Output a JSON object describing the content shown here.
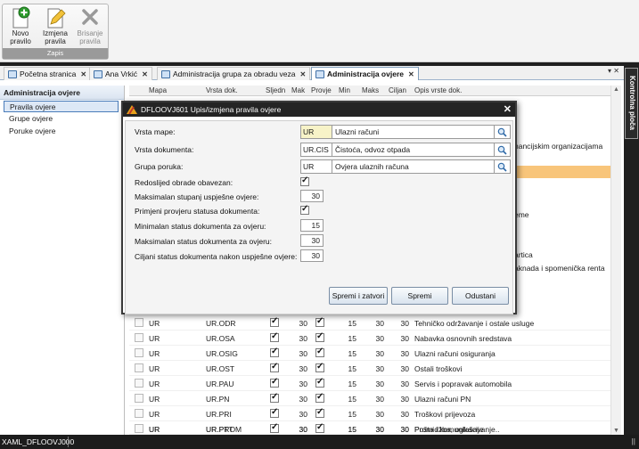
{
  "ribbon": {
    "buttons": [
      {
        "label_line1": "Novo",
        "label_line2": "pravilo",
        "icon": "new-document-icon"
      },
      {
        "label_line1": "Izmjena",
        "label_line2": "pravila",
        "icon": "edit-document-icon"
      },
      {
        "label_line1": "Brisanje",
        "label_line2": "pravila",
        "icon": "delete-x-icon"
      }
    ],
    "group_label": "Zapis"
  },
  "tabs": [
    {
      "label": "Početna stranica"
    },
    {
      "label": "Ana Vrkić"
    },
    {
      "label": "Administracija grupa za obradu veza"
    },
    {
      "label": "Administracija ovjere"
    }
  ],
  "side_panel": {
    "label": "Kontrolna ploča"
  },
  "left_nav": {
    "title": "Administracija ovjere",
    "items": [
      {
        "label": "Pravila ovjere"
      },
      {
        "label": "Grupe ovjere"
      },
      {
        "label": "Poruke ovjere"
      }
    ]
  },
  "grid": {
    "headers": [
      "Mapa",
      "Vrsta dok.",
      "Sljedn",
      "Mak",
      "Provje",
      "Min",
      "Maks",
      "Ciljan",
      "Opis vrste dok."
    ],
    "partial_desc": {
      "r1": "nancijskim organizacijama",
      "r2": "eme",
      "r3": "artica",
      "r4": "aknada i spomenička renta"
    },
    "rows": [
      {
        "mapa": "UR",
        "vrsta": "UR.ODR",
        "mak": "30",
        "min": "15",
        "maks": "30",
        "cilj": "30",
        "opis": "Tehničko održavanje i ostale usluge"
      },
      {
        "mapa": "UR",
        "vrsta": "UR.OSA",
        "mak": "30",
        "min": "15",
        "maks": "30",
        "cilj": "30",
        "opis": "Nabavka osnovnih sredstava"
      },
      {
        "mapa": "UR",
        "vrsta": "UR.OSIG",
        "mak": "30",
        "min": "15",
        "maks": "30",
        "cilj": "30",
        "opis": "Ulazni računi osiguranja"
      },
      {
        "mapa": "UR",
        "vrsta": "UR.OST",
        "mak": "30",
        "min": "15",
        "maks": "30",
        "cilj": "30",
        "opis": "Ostali troškovi"
      },
      {
        "mapa": "UR",
        "vrsta": "UR.PAU",
        "mak": "30",
        "min": "15",
        "maks": "30",
        "cilj": "30",
        "opis": "Servis i popravak automobila"
      },
      {
        "mapa": "UR",
        "vrsta": "UR.PN",
        "mak": "30",
        "min": "15",
        "maks": "30",
        "cilj": "30",
        "opis": "Ulazni računi PN"
      },
      {
        "mapa": "UR",
        "vrsta": "UR.PRI",
        "mak": "30",
        "min": "15",
        "maks": "30",
        "cilj": "30",
        "opis": "Troškovi prijevoza"
      },
      {
        "mapa": "UR",
        "vrsta": "UR.PROM",
        "mak": "30",
        "min": "15",
        "maks": "30",
        "cilj": "30",
        "opis": "Promidžba, oglašavanje.."
      },
      {
        "mapa": "UR",
        "vrsta": "UR.PTT",
        "mak": "30",
        "min": "15",
        "maks": "30",
        "cilj": "30",
        "opis": "Pošta i komunikacije"
      }
    ]
  },
  "modal": {
    "title": "DFLOOVJ601  Upis/izmjena pravila ovjere",
    "fields": {
      "vrsta_mape": {
        "label": "Vrsta mape:",
        "code": "UR",
        "desc": "Ulazni računi"
      },
      "vrsta_dok": {
        "label": "Vrsta dokumenta:",
        "code": "UR.CIS",
        "desc": "Čistoća, odvoz otpada"
      },
      "grupa_poruka": {
        "label": "Grupa poruka:",
        "code": "UR",
        "desc": "Ovjera ulaznih računa"
      },
      "redoslijed": {
        "label": "Redoslijed obrade obavezan:"
      },
      "max_stupanj": {
        "label": "Maksimalan stupanj uspješne ovjere:",
        "value": "30"
      },
      "primjeni": {
        "label": "Primjeni provjeru statusa dokumenta:"
      },
      "min_status": {
        "label": "Minimalan status dokumenta za ovjeru:",
        "value": "15"
      },
      "max_status": {
        "label": "Maksimalan status dokumenta za ovjeru:",
        "value": "30"
      },
      "ciljani": {
        "label": "Ciljani status dokumenta nakon uspješne ovjere:",
        "value": "30"
      }
    },
    "buttons": {
      "save_close": "Spremi i zatvori",
      "save": "Spremi",
      "cancel": "Odustani"
    }
  },
  "status_bar": {
    "text": "XAML_DFLOOVJ000",
    "right": "||"
  },
  "colors": {
    "accent": "#4a7cba",
    "highlight": "#f8c57a",
    "dark": "#1f1f1f"
  }
}
